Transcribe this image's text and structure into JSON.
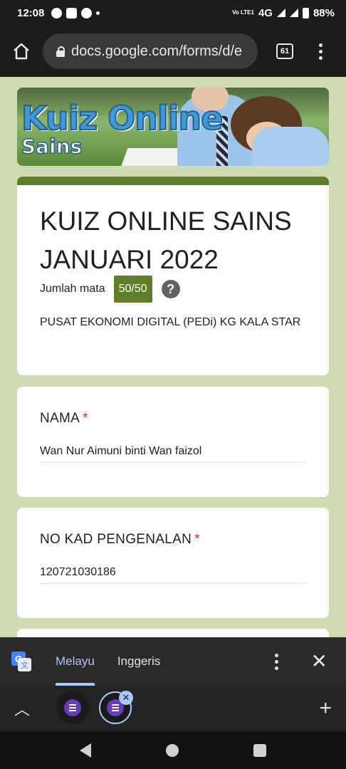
{
  "status_bar": {
    "time": "12:08",
    "network": "4G",
    "volte": "Vo LTE1",
    "battery": "88%"
  },
  "browser": {
    "url": "docs.google.com/forms/d/e",
    "tab_count": "61"
  },
  "banner": {
    "title": "Kuiz Online",
    "subtitle": "Sains"
  },
  "form": {
    "title": "KUIZ ONLINE SAINS JANUARI 2022",
    "score_label": "Jumlah mata",
    "score": "50/50",
    "help": "?",
    "description": "PUSAT EKONOMI DIGITAL (PEDi) KG KALA STAR"
  },
  "questions": [
    {
      "label": "NAMA",
      "required": "*",
      "answer": "Wan Nur Aimuni binti Wan faizol"
    },
    {
      "label": "NO KAD PENGENALAN",
      "required": "*",
      "answer": "120721030186"
    }
  ],
  "translate_bar": {
    "active_lang": "Melayu",
    "other_lang": "Inggeris"
  },
  "colors": {
    "accent": "#5e7f2a",
    "background": "#cfdcb3",
    "required": "#d93025"
  }
}
